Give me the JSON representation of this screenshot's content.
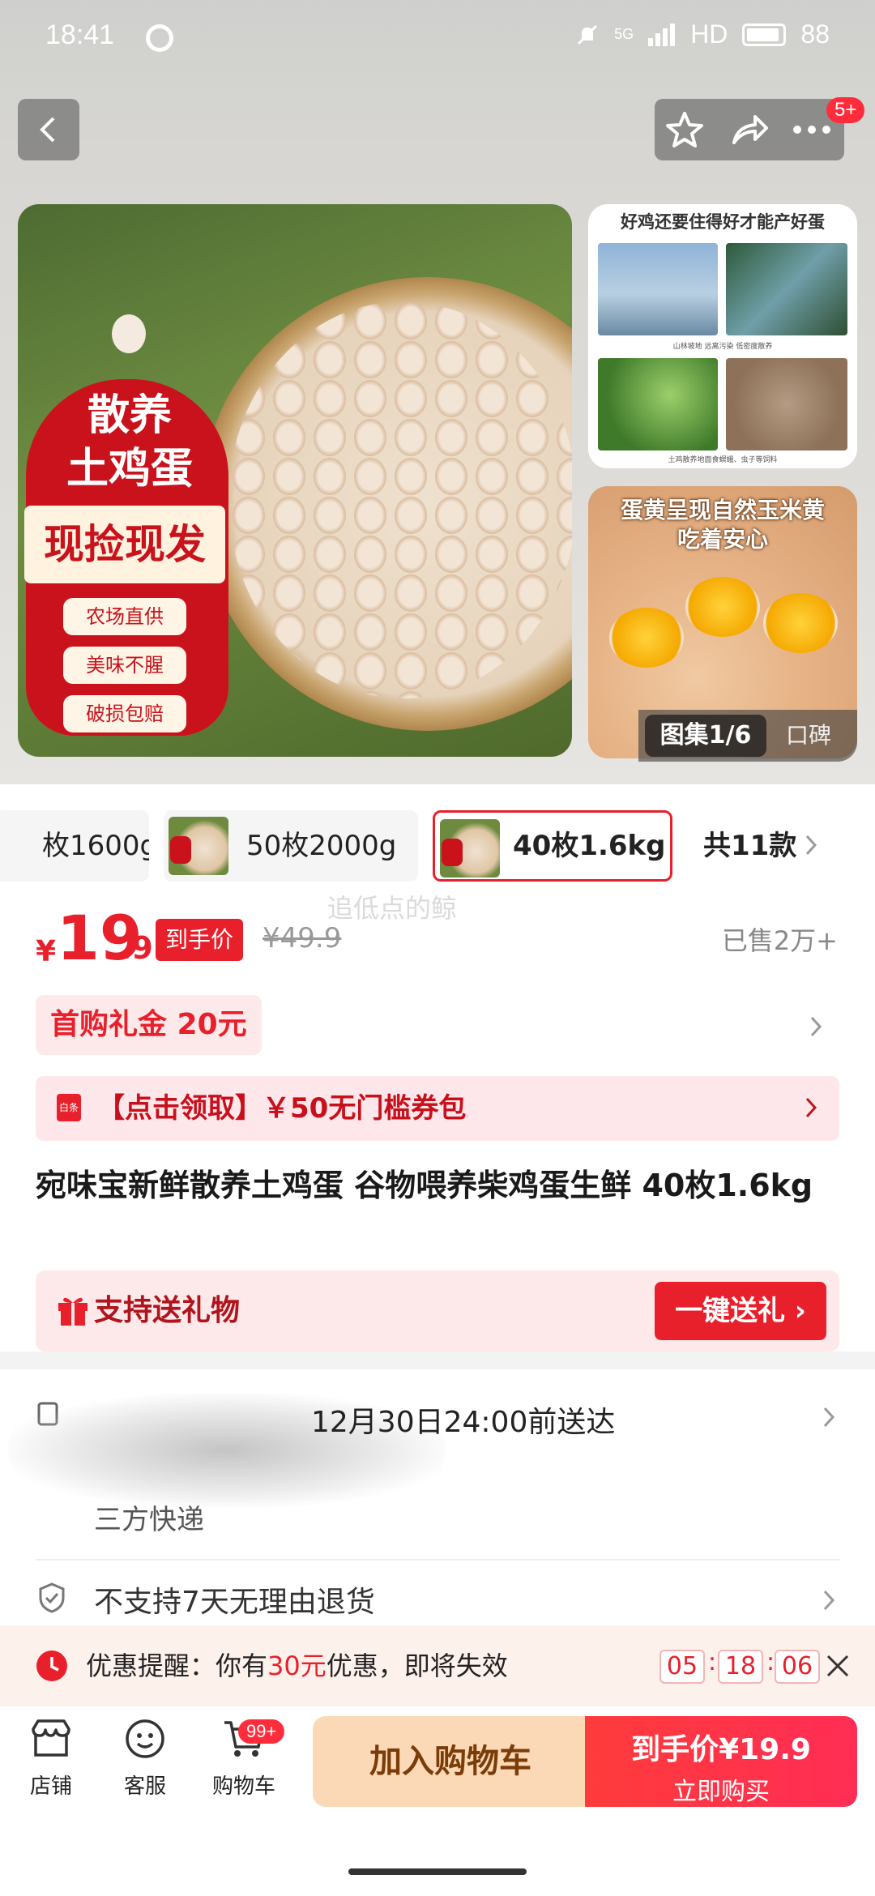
{
  "status_bar": {
    "time": "18:41",
    "network": "5G",
    "hd": "HD",
    "battery": "88"
  },
  "top": {
    "cart_badge": "5+"
  },
  "gallery": {
    "promo_title_line1": "散养",
    "promo_title_line2": "土鸡蛋",
    "promo_band": "现捡现发",
    "promo_chips": [
      "农场直供",
      "美味不腥",
      "破损包赔"
    ],
    "side1_title": "好鸡还要住得好才能产好蛋",
    "side1_caption1": "山林坡地 远离污染 低密度散养",
    "side1_caption2": "土鸡散养地面食螟蛾、虫子等饲料",
    "side2_title_line1": "蛋黄呈现自然玉米黄",
    "side2_title_line2": "吃着安心",
    "counter": "图集1/6",
    "reviews": "口碑"
  },
  "variants": {
    "items": [
      {
        "label": "枚1600g"
      },
      {
        "label": "50枚2000g"
      },
      {
        "label": "40枚1.6kg"
      }
    ],
    "count": "共11款"
  },
  "watermark": "追低点的鲸",
  "price": {
    "symbol": "¥",
    "integer": "19",
    "decimal": ".9",
    "tag": "到手价",
    "original": "¥49.9",
    "sold": "已售2万+"
  },
  "first_gift": "首购礼金  20元",
  "coupon": {
    "icon": "白条",
    "text": "【点击领取】￥50无门槛券包"
  },
  "product_title": "宛味宝新鲜散养土鸡蛋 谷物喂养柴鸡蛋生鲜 40枚1.6kg",
  "send_gift": {
    "label": "支持送礼物",
    "button": "一键送礼"
  },
  "delivery": {
    "time": "12月30日24:00前送达",
    "carrier": "三方快递",
    "return_policy": "不支持7天无理由退货"
  },
  "reminder": {
    "prefix": "优惠提醒：你有",
    "amount": "30元",
    "suffix": "优惠，即将失效",
    "hh": "05",
    "mm": "18",
    "ss": "06"
  },
  "bottom_nav": {
    "store": "店铺",
    "service": "客服",
    "cart": "购物车",
    "cart_badge": "99+",
    "add_cart": "加入购物车",
    "buy_price": "到手价¥19.9",
    "buy_now": "立即购买"
  },
  "colors": {
    "accent": "#e8202c",
    "buy_gradient_end": "#ff2d55",
    "add_cart_bg": "#fbd9b6"
  }
}
